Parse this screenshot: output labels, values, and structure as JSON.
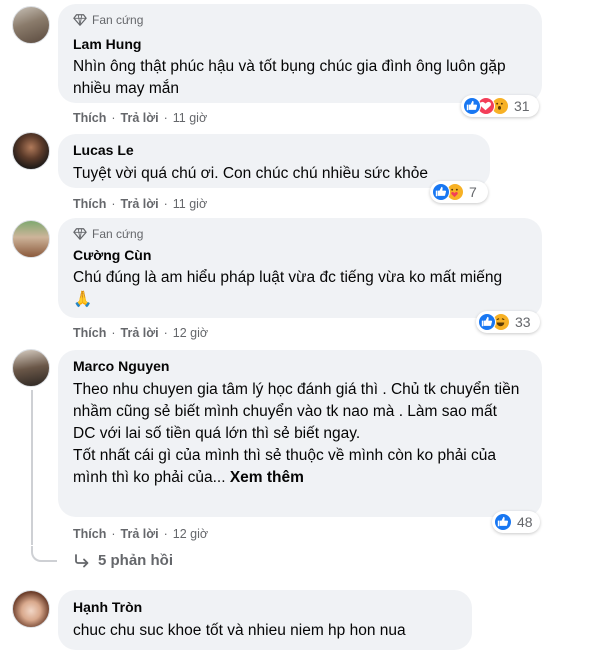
{
  "comments": [
    {
      "badge": "Fan cứng",
      "name": "Lam Hung",
      "text": "Nhìn ông thật phúc hậu và tốt bụng chúc gia đình ông luôn gặp nhiều may mắn",
      "like": "Thích",
      "reply": "Trả lời",
      "time": "11 giờ",
      "reaction_icons": [
        "like-icon",
        "love-icon",
        "wow-icon"
      ],
      "reaction_count": "31"
    },
    {
      "name": "Lucas Le",
      "text": "Tuyệt vời quá chú ơi. Con chúc chú nhiều sức khỏe",
      "like": "Thích",
      "reply": "Trả lời",
      "time": "11 giờ",
      "reaction_icons": [
        "like-icon",
        "care-icon"
      ],
      "reaction_count": "7"
    },
    {
      "badge": "Fan cứng",
      "name": "Cường Cùn",
      "text": "Chú đúng là am hiểu pháp luật vừa đc tiếng vừa ko mất miếng 🙏",
      "like": "Thích",
      "reply": "Trả lời",
      "time": "12 giờ",
      "reaction_icons": [
        "like-icon",
        "haha-icon"
      ],
      "reaction_count": "33"
    },
    {
      "name": "Marco Nguyen",
      "text_lines": [
        "Theo nhu chuyen gia tâm lý học đánh giá thì . Chủ tk chuyển tiền nhầm cũng sẻ biết mình chuyển vào tk nao mà . Làm sao mất DC với lai số tiền quá lớn thì sẻ biết ngay.",
        "Tốt nhất cái gì của mình thì sẻ thuộc về mình còn ko phải của mình thì ko phải của..."
      ],
      "see_more": "Xem thêm",
      "like": "Thích",
      "reply": "Trả lời",
      "time": "12 giờ",
      "reaction_icons": [
        "like-icon"
      ],
      "reaction_count": "48",
      "replies_label": "5 phản hồi"
    },
    {
      "name": "Hạnh Tròn",
      "text": "chuc chu suc khoe tốt và nhieu niem hp hon nua"
    }
  ],
  "colors": {
    "like": "#1877f2",
    "love": "#f33e58",
    "wow": "#f7b125",
    "bubble": "#f0f2f5",
    "meta": "#65676b"
  }
}
